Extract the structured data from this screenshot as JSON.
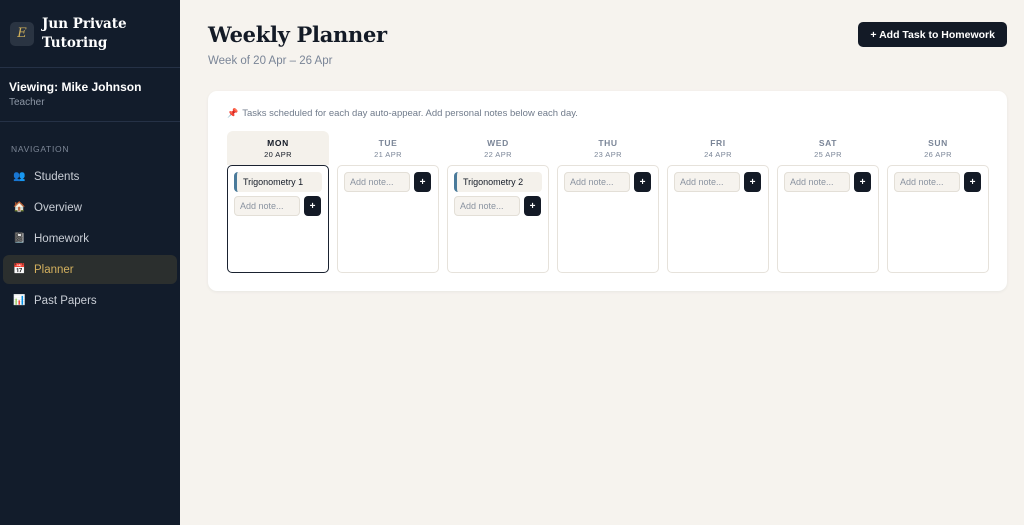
{
  "brand": {
    "logo_letter": "E",
    "name": "Jun Private Tutoring"
  },
  "viewer": {
    "label": "Viewing: Mike Johnson",
    "role": "Teacher"
  },
  "nav": {
    "title": "NAVIGATION",
    "items": [
      {
        "label": "Students",
        "icon": "students-icon",
        "glyph": "👥"
      },
      {
        "label": "Overview",
        "icon": "house-icon",
        "glyph": "🏠"
      },
      {
        "label": "Homework",
        "icon": "notebook-icon",
        "glyph": "📓"
      },
      {
        "label": "Planner",
        "icon": "calendar-icon",
        "glyph": "📅",
        "active": true
      },
      {
        "label": "Past Papers",
        "icon": "bar-chart-icon",
        "glyph": "📊"
      }
    ]
  },
  "header": {
    "title": "Weekly Planner",
    "subtitle": "Week of 20 Apr – 26 Apr",
    "add_button": "+ Add Task to Homework"
  },
  "planner": {
    "hint_icon": "pushpin-icon",
    "hint": "Tasks scheduled for each day auto-appear. Add personal notes below each day.",
    "note_placeholder": "Add note...",
    "note_button": "+",
    "days": [
      {
        "name": "MON",
        "date": "20 APR",
        "today": true,
        "tasks": [
          "Trigonometry 1"
        ]
      },
      {
        "name": "TUE",
        "date": "21 APR",
        "tasks": []
      },
      {
        "name": "WED",
        "date": "22 APR",
        "tasks": [
          "Trigonometry 2"
        ]
      },
      {
        "name": "THU",
        "date": "23 APR",
        "tasks": []
      },
      {
        "name": "FRI",
        "date": "24 APR",
        "tasks": []
      },
      {
        "name": "SAT",
        "date": "25 APR",
        "tasks": []
      },
      {
        "name": "SUN",
        "date": "26 APR",
        "tasks": []
      }
    ]
  },
  "colors": {
    "sidebar": "#121c2b",
    "accent": "#d3b05e",
    "background": "#f6f3ee",
    "task_bar": "#4a7a9a"
  }
}
